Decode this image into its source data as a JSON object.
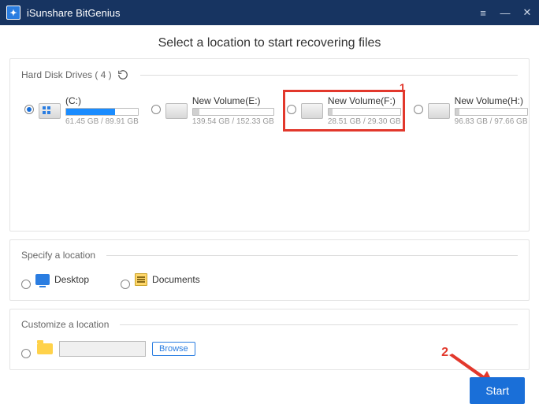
{
  "app": {
    "title": "iSunshare BitGenius"
  },
  "subtitle": "Select a location to start recovering files",
  "sections": {
    "drives_label": "Hard Disk Drives ( 4 )",
    "specify_label": "Specify a location",
    "customize_label": "Customize a location"
  },
  "drives": [
    {
      "label": "(C:)",
      "size": "61.45 GB / 89.91 GB",
      "fill_pct": 68,
      "selected": true,
      "win": true
    },
    {
      "label": "New Volume(E:)",
      "size": "139.54 GB / 152.33 GB",
      "fill_pct": 8,
      "selected": false,
      "win": false
    },
    {
      "label": "New Volume(F:)",
      "size": "28.51 GB / 29.30 GB",
      "fill_pct": 6,
      "selected": false,
      "win": false,
      "highlight": true
    },
    {
      "label": "New Volume(H:)",
      "size": "96.83 GB / 97.66 GB",
      "fill_pct": 6,
      "selected": false,
      "win": false
    }
  ],
  "locations": {
    "desktop": "Desktop",
    "documents": "Documents"
  },
  "buttons": {
    "browse": "Browse",
    "start": "Start"
  },
  "annotations": {
    "one": "1",
    "two": "2"
  }
}
